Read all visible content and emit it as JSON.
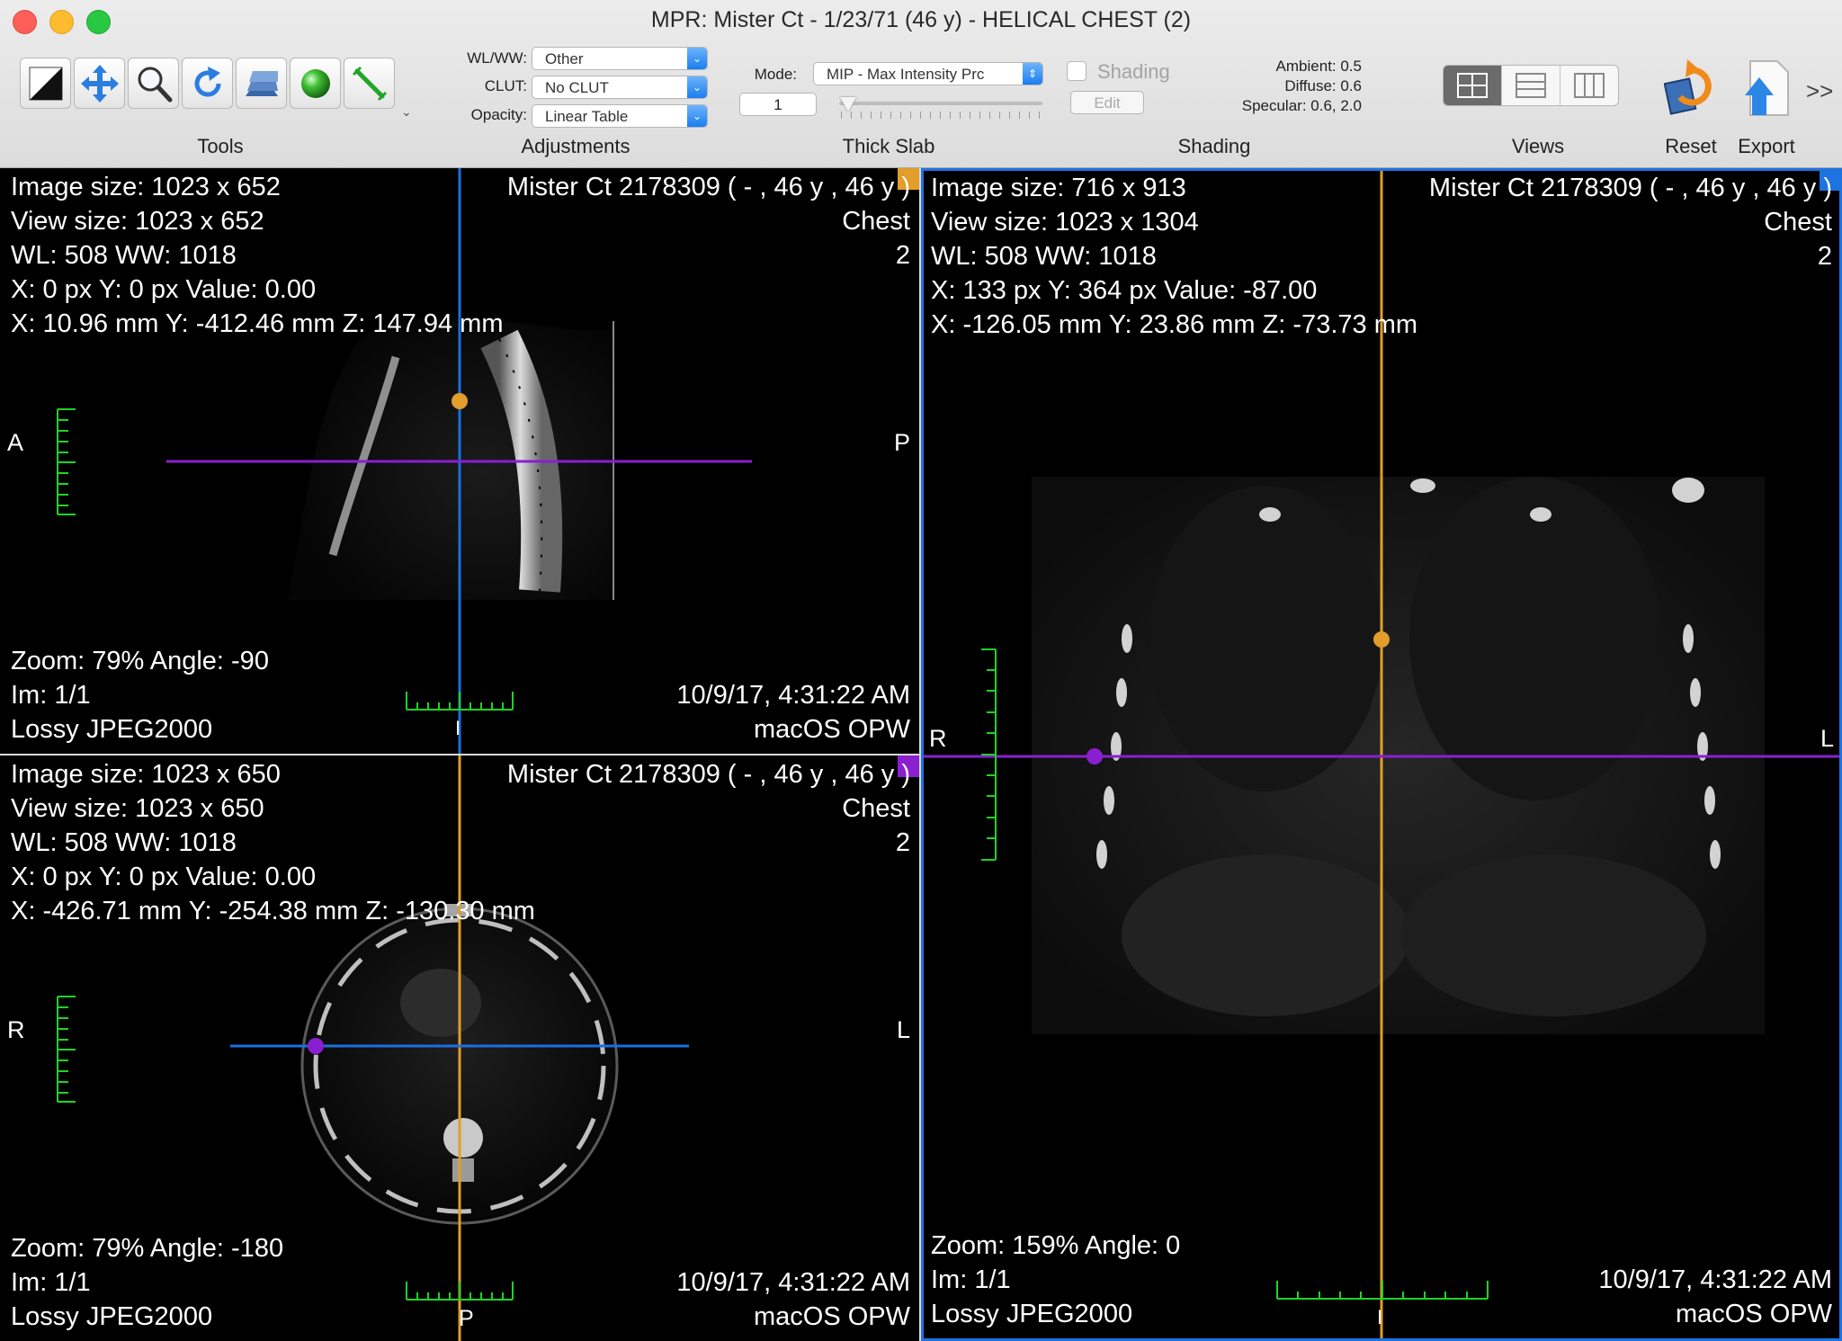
{
  "window": {
    "title": "MPR: Mister Ct - 1/23/71 (46 y) - HELICAL CHEST (2)"
  },
  "toolbar": {
    "groups": {
      "tools": "Tools",
      "adjustments": "Adjustments",
      "thick_slab": "Thick Slab",
      "shading": "Shading",
      "views": "Views",
      "reset": "Reset",
      "export": "Export"
    },
    "tools": [
      "window-level-icon",
      "move-icon",
      "zoom-icon",
      "rotate-icon",
      "stack-icon",
      "sphere-icon",
      "ruler-icon"
    ],
    "adjustments": {
      "wlww_label": "WL/WW:",
      "wlww_value": "Other",
      "clut_label": "CLUT:",
      "clut_value": "No CLUT",
      "opacity_label": "Opacity:",
      "opacity_value": "Linear Table"
    },
    "thick_slab": {
      "mode_label": "Mode:",
      "mode_value": "MIP - Max Intensity Prc",
      "thickness_value": "1"
    },
    "shading": {
      "checkbox_label": "Shading",
      "edit_label": "Edit",
      "ambient": "Ambient: 0.5",
      "diffuse": "Diffuse: 0.6",
      "specular": "Specular: 0.6, 2.0"
    },
    "more": ">>"
  },
  "viewports": {
    "sagittal": {
      "image_size": "Image size: 1023 x 652",
      "view_size": "View size: 1023 x 652",
      "wl": "WL: 508 WW: 1018",
      "px": "X: 0 px Y: 0 px Value: 0.00",
      "mm": "X: 10.96 mm Y: -412.46 mm Z: 147.94 mm",
      "patient": "Mister Ct 2178309 ( - ,  46 y ,  46 y )",
      "study": "Chest",
      "series": "2",
      "zoom": "Zoom: 79% Angle: -90",
      "im": "Im: 1/1",
      "compression": "Lossy JPEG2000",
      "date": "10/9/17, 4:31:22 AM",
      "institution": "macOS OPW",
      "orient_left": "A",
      "orient_right": "P",
      "orient_bottom": "I"
    },
    "axial": {
      "image_size": "Image size: 1023 x 650",
      "view_size": "View size: 1023 x 650",
      "wl": "WL: 508 WW: 1018",
      "px": "X: 0 px Y: 0 px Value: 0.00",
      "mm": "X: -426.71 mm Y: -254.38 mm Z: -130.30 mm",
      "patient": "Mister Ct 2178309 ( - ,  46 y ,  46 y )",
      "study": "Chest",
      "series": "2",
      "zoom": "Zoom: 79% Angle: -180",
      "im": "Im: 1/1",
      "compression": "Lossy JPEG2000",
      "date": "10/9/17, 4:31:22 AM",
      "institution": "macOS OPW",
      "orient_left": "R",
      "orient_right": "L",
      "orient_bottom": "P"
    },
    "coronal": {
      "image_size": "Image size: 716 x 913",
      "view_size": "View size: 1023 x 1304",
      "wl": "WL: 508 WW: 1018",
      "px": "X: 133 px Y: 364 px Value: -87.00",
      "mm": "X: -126.05 mm Y: 23.86 mm Z: -73.73 mm",
      "patient": "Mister Ct 2178309 ( - ,  46 y ,  46 y )",
      "study": "Chest",
      "series": "2",
      "zoom": "Zoom: 159% Angle: 0",
      "im": "Im: 1/1",
      "compression": "Lossy JPEG2000",
      "date": "10/9/17, 4:31:22 AM",
      "institution": "macOS OPW",
      "orient_left": "R",
      "orient_right": "L",
      "orient_bottom": "I"
    }
  },
  "colors": {
    "crosshair_blue": "#1a6fe0",
    "crosshair_orange": "#e29d2a",
    "crosshair_purple": "#8a1fd0",
    "scale_green": "#1fd324",
    "active_border": "#1d73e0"
  }
}
